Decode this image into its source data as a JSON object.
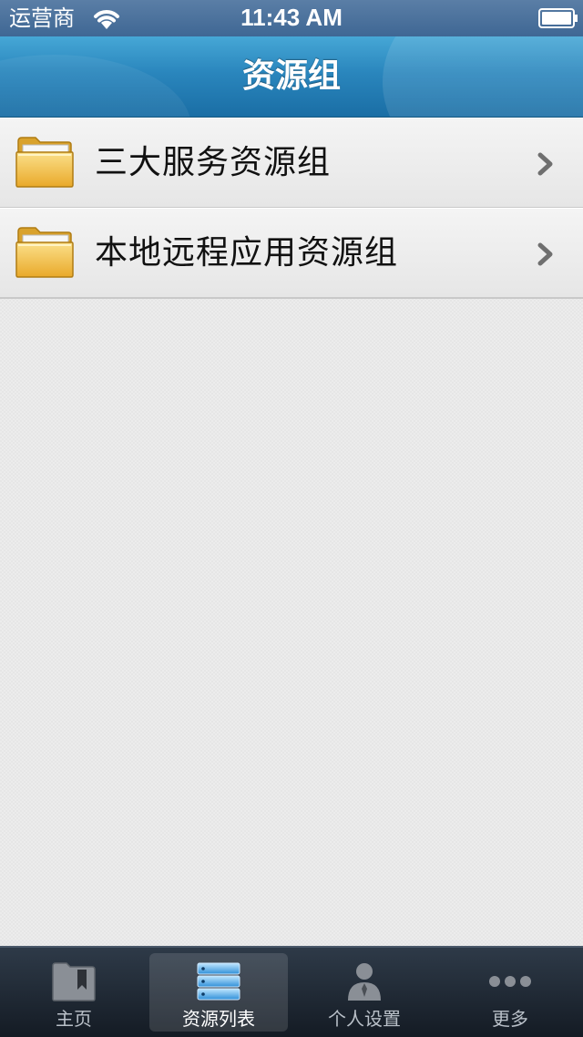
{
  "status_bar": {
    "carrier": "运营商",
    "time": "11:43 AM"
  },
  "nav": {
    "title": "资源组"
  },
  "list": {
    "items": [
      {
        "label": "三大服务资源组",
        "icon": "folder-icon"
      },
      {
        "label": "本地远程应用资源组",
        "icon": "folder-icon"
      }
    ]
  },
  "tab_bar": {
    "active_index": 1,
    "tabs": [
      {
        "label": "主页",
        "icon": "bookmark-folder-icon"
      },
      {
        "label": "资源列表",
        "icon": "server-stack-icon"
      },
      {
        "label": "个人设置",
        "icon": "person-icon"
      },
      {
        "label": "更多",
        "icon": "more-dots-icon"
      }
    ]
  },
  "colors": {
    "nav_blue": "#2a86bd",
    "tab_bar_dark": "#1f2935",
    "folder_yellow": "#f1c33e"
  }
}
